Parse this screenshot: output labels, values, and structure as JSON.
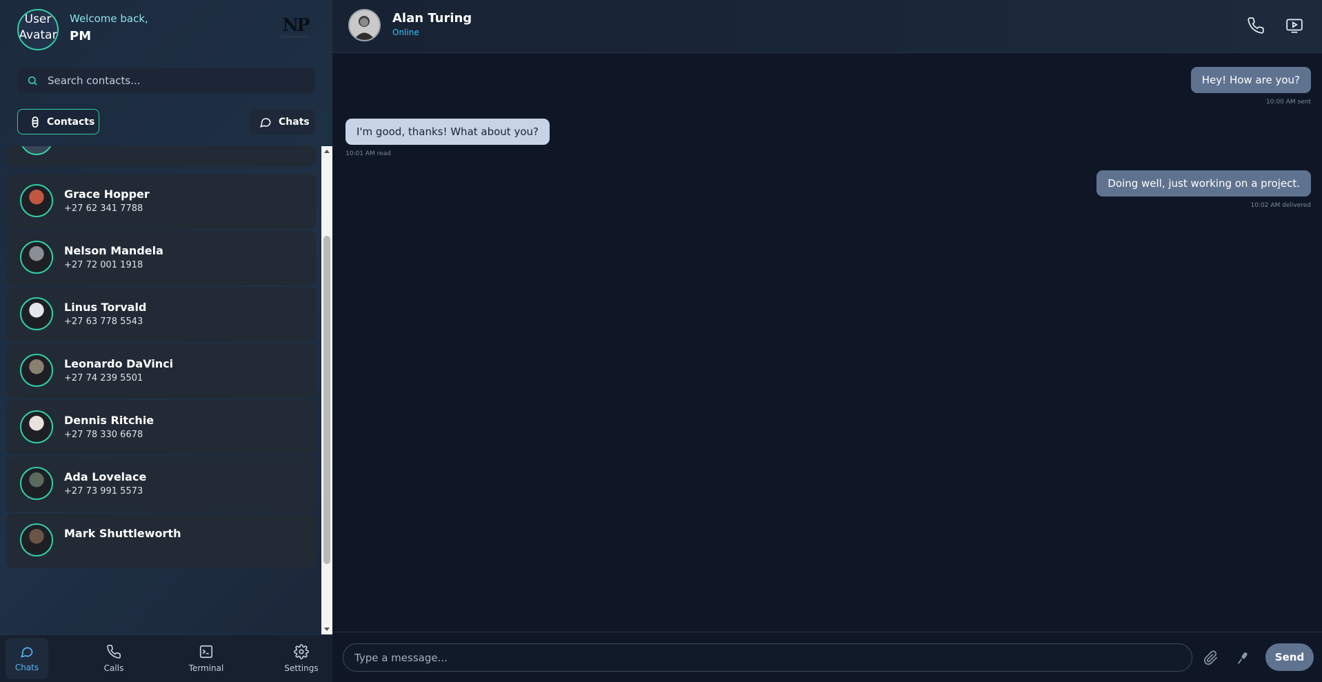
{
  "user": {
    "avatar_alt": "User Avatar",
    "welcome": "Welcome back,",
    "name": "PM",
    "logo": "NP"
  },
  "search": {
    "placeholder": "Search contacts..."
  },
  "tabs": {
    "contacts": "Contacts",
    "chats": "Chats"
  },
  "contacts": [
    {
      "name": "Grace Hopper",
      "phone": "+27 62 341 7788",
      "avatar_color": "#c2573f"
    },
    {
      "name": "Nelson Mandela",
      "phone": "+27 72 001 1918",
      "avatar_color": "#8a8f96"
    },
    {
      "name": "Linus Torvald",
      "phone": "+27 63 778 5543",
      "avatar_color": "#e3e6ea"
    },
    {
      "name": "Leonardo DaVinci",
      "phone": "+27 74 239 5501",
      "avatar_color": "#8a8070"
    },
    {
      "name": "Dennis Ritchie",
      "phone": "+27 78 330 6678",
      "avatar_color": "#e8e1dc"
    },
    {
      "name": "Ada Lovelace",
      "phone": "+27 73 991 5573",
      "avatar_color": "#5a6a5e"
    },
    {
      "name": "Mark Shuttleworth",
      "phone": "",
      "avatar_color": "#6a5446"
    }
  ],
  "nav": {
    "chats": "Chats",
    "calls": "Calls",
    "terminal": "Terminal",
    "settings": "Settings"
  },
  "chat": {
    "name": "Alan Turing",
    "status": "Online",
    "messages": [
      {
        "direction": "sent",
        "text": "Hey! How are you?",
        "meta": "10:00 AM sent"
      },
      {
        "direction": "received",
        "text": "I'm good, thanks! What about you?",
        "meta": "10:01 AM read"
      },
      {
        "direction": "sent",
        "text": "Doing well, just working on a project.",
        "meta": "10:02 AM delivered"
      }
    ]
  },
  "composer": {
    "placeholder": "Type a message...",
    "send": "Send"
  },
  "colors": {
    "accent": "#2fd0a6",
    "online": "#2ec4ff",
    "sent_bubble": "#5f7390",
    "received_bubble": "#c6d4e6",
    "active_nav": "#56b8f4"
  }
}
